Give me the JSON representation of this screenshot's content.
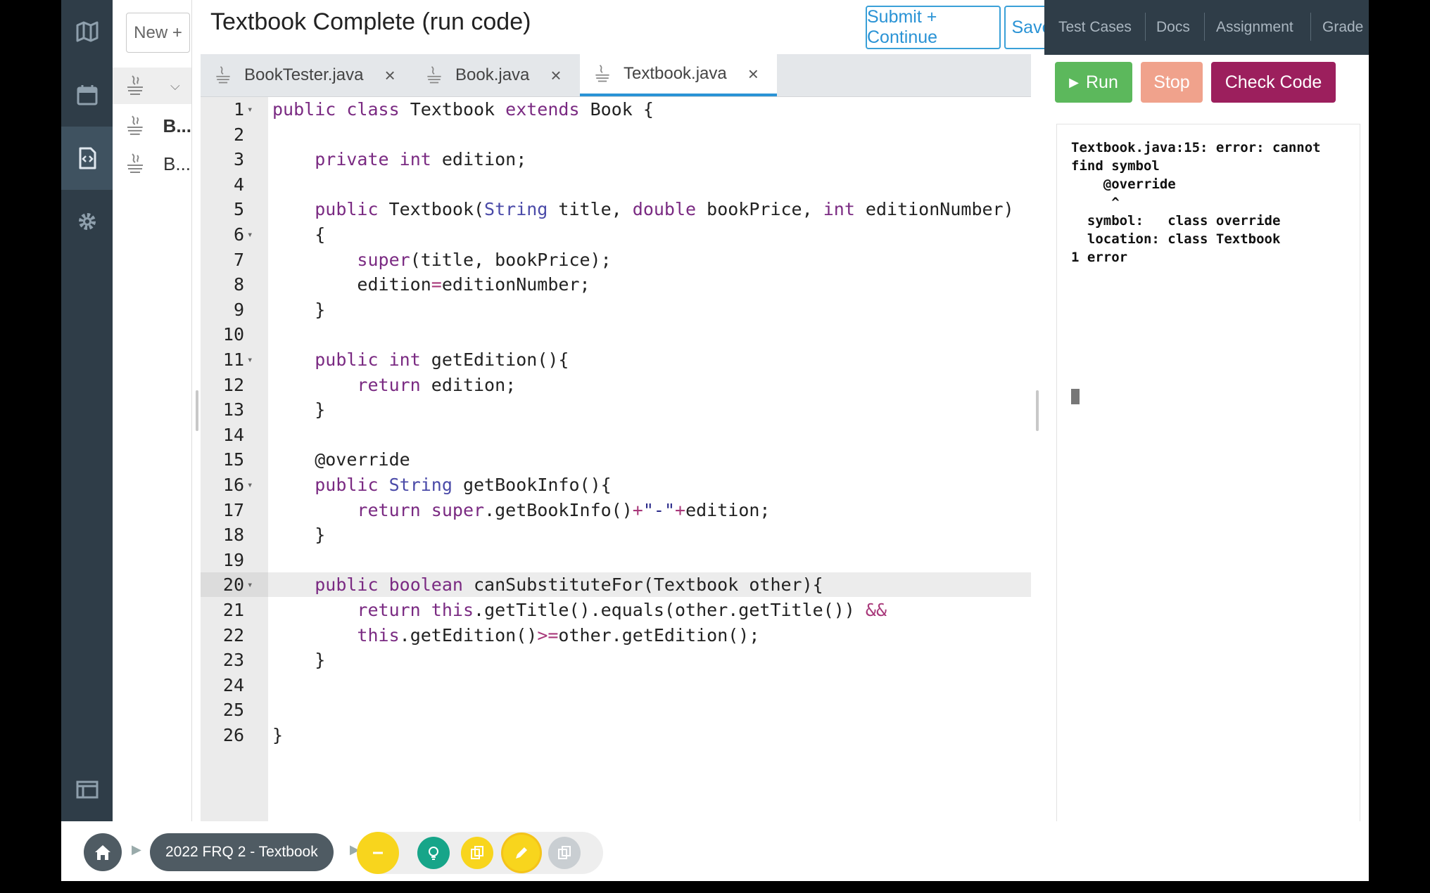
{
  "header": {
    "title": "Textbook Complete (run code)",
    "submit_label": "Submit + Continue",
    "save_label": "Save"
  },
  "file_panel": {
    "new_label": "New +",
    "files": [
      "",
      "B...",
      "B..."
    ]
  },
  "tabs": [
    {
      "label": "BookTester.java",
      "close": "×"
    },
    {
      "label": "Book.java",
      "close": "×"
    },
    {
      "label": "Textbook.java",
      "close": "×"
    }
  ],
  "editor": {
    "active_line": 20,
    "lines": [
      {
        "n": "1",
        "fold": true
      },
      {
        "n": "2"
      },
      {
        "n": "3"
      },
      {
        "n": "4"
      },
      {
        "n": "5"
      },
      {
        "n": "6",
        "fold": true
      },
      {
        "n": "7"
      },
      {
        "n": "8"
      },
      {
        "n": "9"
      },
      {
        "n": "10"
      },
      {
        "n": "11",
        "fold": true
      },
      {
        "n": "12"
      },
      {
        "n": "13"
      },
      {
        "n": "14"
      },
      {
        "n": "15"
      },
      {
        "n": "16",
        "fold": true
      },
      {
        "n": "17"
      },
      {
        "n": "18"
      },
      {
        "n": "19"
      },
      {
        "n": "20",
        "fold": true
      },
      {
        "n": "21"
      },
      {
        "n": "22"
      },
      {
        "n": "23"
      },
      {
        "n": "24"
      },
      {
        "n": "25"
      },
      {
        "n": "26"
      }
    ],
    "code": [
      "public class Textbook extends Book {",
      "",
      "    private int edition;",
      "",
      "    public Textbook(String title, double bookPrice, int editionNumber)",
      "    {",
      "        super(title, bookPrice);",
      "        edition=editionNumber;",
      "    }",
      "",
      "    public int getEdition(){",
      "        return edition;",
      "    }",
      "",
      "    @override",
      "    public String getBookInfo(){",
      "        return super.getBookInfo()+\"-\"+edition;",
      "    }",
      "",
      "    public boolean canSubstituteFor(Textbook other){",
      "        return this.getTitle().equals(other.getTitle()) &&",
      "        this.getEdition()>=other.getEdition();",
      "    }",
      "",
      "",
      "}"
    ]
  },
  "right_panel": {
    "tabs": [
      "Test Cases",
      "Docs",
      "Assignment",
      "Grade"
    ],
    "run_label": "Run",
    "stop_label": "Stop",
    "check_label": "Check Code",
    "console_output": "Textbook.java:15: error: cannot\nfind symbol\n    @override\n     ^\n  symbol:   class override\n  location: class Textbook\n1 error"
  },
  "bottom": {
    "breadcrumb": "2022 FRQ 2 - Textbook"
  },
  "colors": {
    "rail": "#2f3d48",
    "accent_blue": "#2a93d5",
    "run_green": "#5cb85c",
    "stop_salmon": "#f0a28c",
    "check_maroon": "#9c1f5d",
    "keyword": "#7a2a82"
  }
}
